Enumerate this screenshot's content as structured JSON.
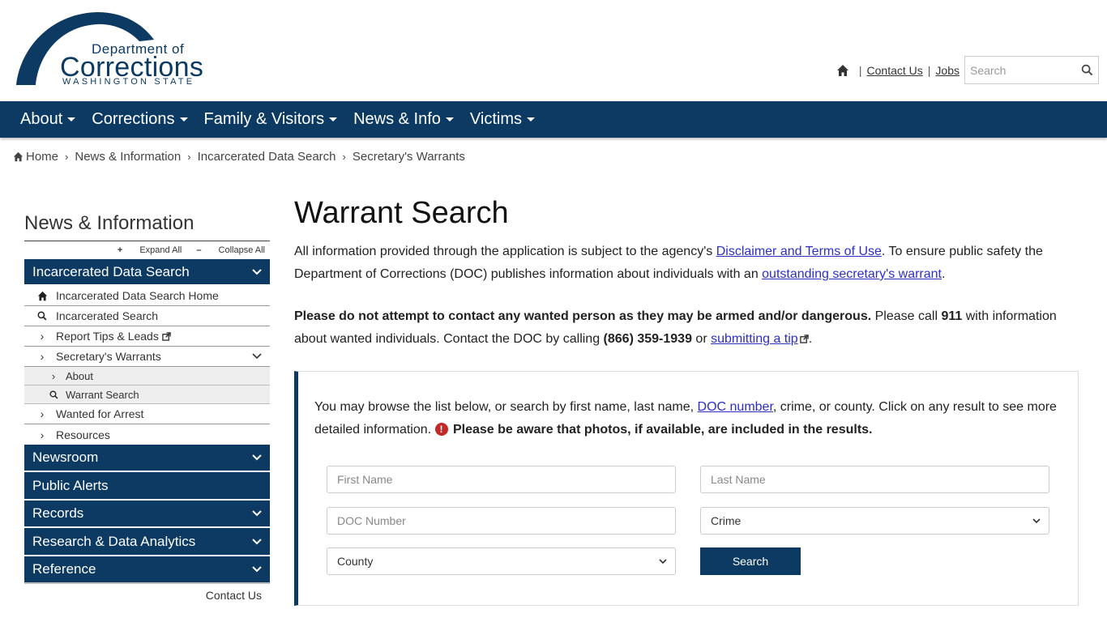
{
  "logo": {
    "line1": "Department of",
    "line2": "Corrections",
    "line3": "WASHINGTON STATE"
  },
  "utility": {
    "contact": "Contact Us",
    "jobs": "Jobs",
    "search_placeholder": "Search"
  },
  "nav": {
    "items": [
      "About",
      "Corrections",
      "Family & Visitors",
      "News & Info",
      "Victims"
    ]
  },
  "breadcrumb": [
    "Home",
    "News & Information",
    "Incarcerated Data Search",
    "Secretary's Warrants"
  ],
  "sidebar": {
    "title": "News & Information",
    "expand_all": "Expand All",
    "collapse_all": "Collapse All",
    "section_incarcerated": "Incarcerated Data Search",
    "sub_items": [
      "Incarcerated Data Search Home",
      "Incarcerated Search",
      "Report Tips & Leads",
      "Secretary's Warrants"
    ],
    "warrant_children": [
      "About",
      "Warrant Search"
    ],
    "more_items": [
      "Wanted for Arrest",
      "Resources"
    ],
    "sections": [
      "Newsroom",
      "Public Alerts",
      "Records",
      "Research & Data Analytics",
      "Reference"
    ],
    "contact": "Contact Us"
  },
  "main": {
    "title": "Warrant Search",
    "p1_a": "All information provided through the application is subject to the agency's ",
    "p1_link1": "Disclaimer and Terms of Use",
    "p1_b": ". To ensure public safety the Department of Corrections (DOC) publishes information about individuals with an ",
    "p1_link2": "outstanding secretary's warrant",
    "p1_c": ".",
    "p2_bold": "Please do not attempt to contact any wanted person as they may be armed and/or dangerous.",
    "p2_a": " Please call ",
    "p2_911": "911",
    "p2_b": " with information about wanted individuals. Contact the DOC by calling ",
    "p2_phone": "(866) 359-1939",
    "p2_c": " or ",
    "p2_link": "submitting a tip",
    "p2_d": "."
  },
  "panel": {
    "intro_a": "You may browse the list below, or search by first name, last name, ",
    "intro_link": "DOC number",
    "intro_b": ", crime, or county. Click on any result to see more detailed information. ",
    "intro_bold": "Please be aware that photos, if available, are included in the results.",
    "first_name": "First Name",
    "last_name": "Last Name",
    "doc_number": "DOC Number",
    "crime": "Crime",
    "county": "County",
    "search_button": "Search"
  },
  "colors": {
    "brand_navy": "#0c3a63",
    "link": "#2d2fc4",
    "alert_red": "#c62828"
  }
}
